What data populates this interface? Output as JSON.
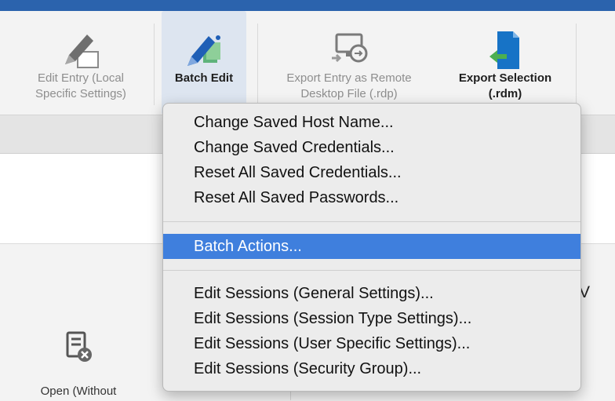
{
  "ribbon": {
    "buttons": [
      {
        "label_line1": "Edit Entry (Local",
        "label_line2": "Specific Settings)",
        "icon": "pencil-window-icon",
        "enabled": false
      },
      {
        "label_line1": "Batch Edit",
        "label_line2": "",
        "icon": "batch-edit-pencil-icon",
        "enabled": true,
        "dropdown": true
      },
      {
        "label_line1": "Export Entry as Remote",
        "label_line2": "Desktop File (.rdp)",
        "icon": "rdp-export-icon",
        "enabled": false
      },
      {
        "label_line1": "Export Selection",
        "label_line2": "(.rdm)",
        "icon": "rdm-export-icon",
        "enabled": true
      }
    ]
  },
  "menu": {
    "items": [
      "Change Saved Host Name...",
      "Change Saved Credentials...",
      "Reset All Saved Credentials...",
      "Reset All Saved Passwords...",
      "Batch Actions...",
      "Edit Sessions (General Settings)...",
      "Edit Sessions (Session Type Settings)...",
      "Edit Sessions (User Specific Settings)...",
      "Edit Sessions (Security Group)..."
    ],
    "highlighted_index": 4
  },
  "lower": {
    "open_label": "Open (Without",
    "partial_text": "V"
  },
  "colors": {
    "accent": "#2b63ad",
    "highlight": "#3f7fdd",
    "export_icon": "#1773c6",
    "arrow_green": "#4caf50"
  }
}
